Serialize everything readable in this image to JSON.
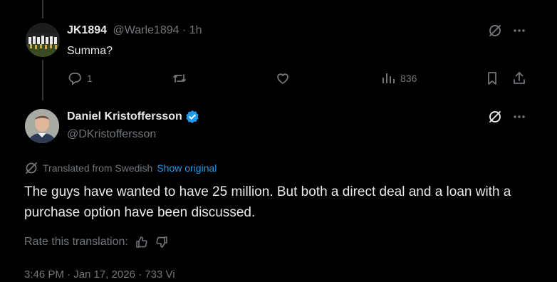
{
  "reply": {
    "display_name": "JK1894",
    "handle": "@Warle1894",
    "separator": "·",
    "time": "1h",
    "text": "Summa?",
    "actions": {
      "reply_count": "1",
      "views_count": "836"
    }
  },
  "main_post": {
    "display_name": "Daniel Kristoffersson",
    "handle": "@DKristoffersson",
    "translated_label": "Translated from Swedish",
    "show_original": "Show original",
    "text": "The guys have wanted to have 25 million. But both a direct deal and a loan with a purchase option have been discussed.",
    "rate_label": "Rate this translation:",
    "footer_partial": "3:46 PM · Jan 17, 2026 · 733 Vi"
  },
  "colors": {
    "background": "#000000",
    "text": "#e7e9ea",
    "muted": "#71767b",
    "accent": "#1d9bf0",
    "verified": "#1d9bf0"
  },
  "icons": [
    "grok-icon",
    "more-icon",
    "reply-icon",
    "retweet-icon",
    "like-icon",
    "views-icon",
    "bookmark-icon",
    "share-icon",
    "verified-badge-icon",
    "translate-icon",
    "thumbs-up-icon",
    "thumbs-down-icon"
  ]
}
